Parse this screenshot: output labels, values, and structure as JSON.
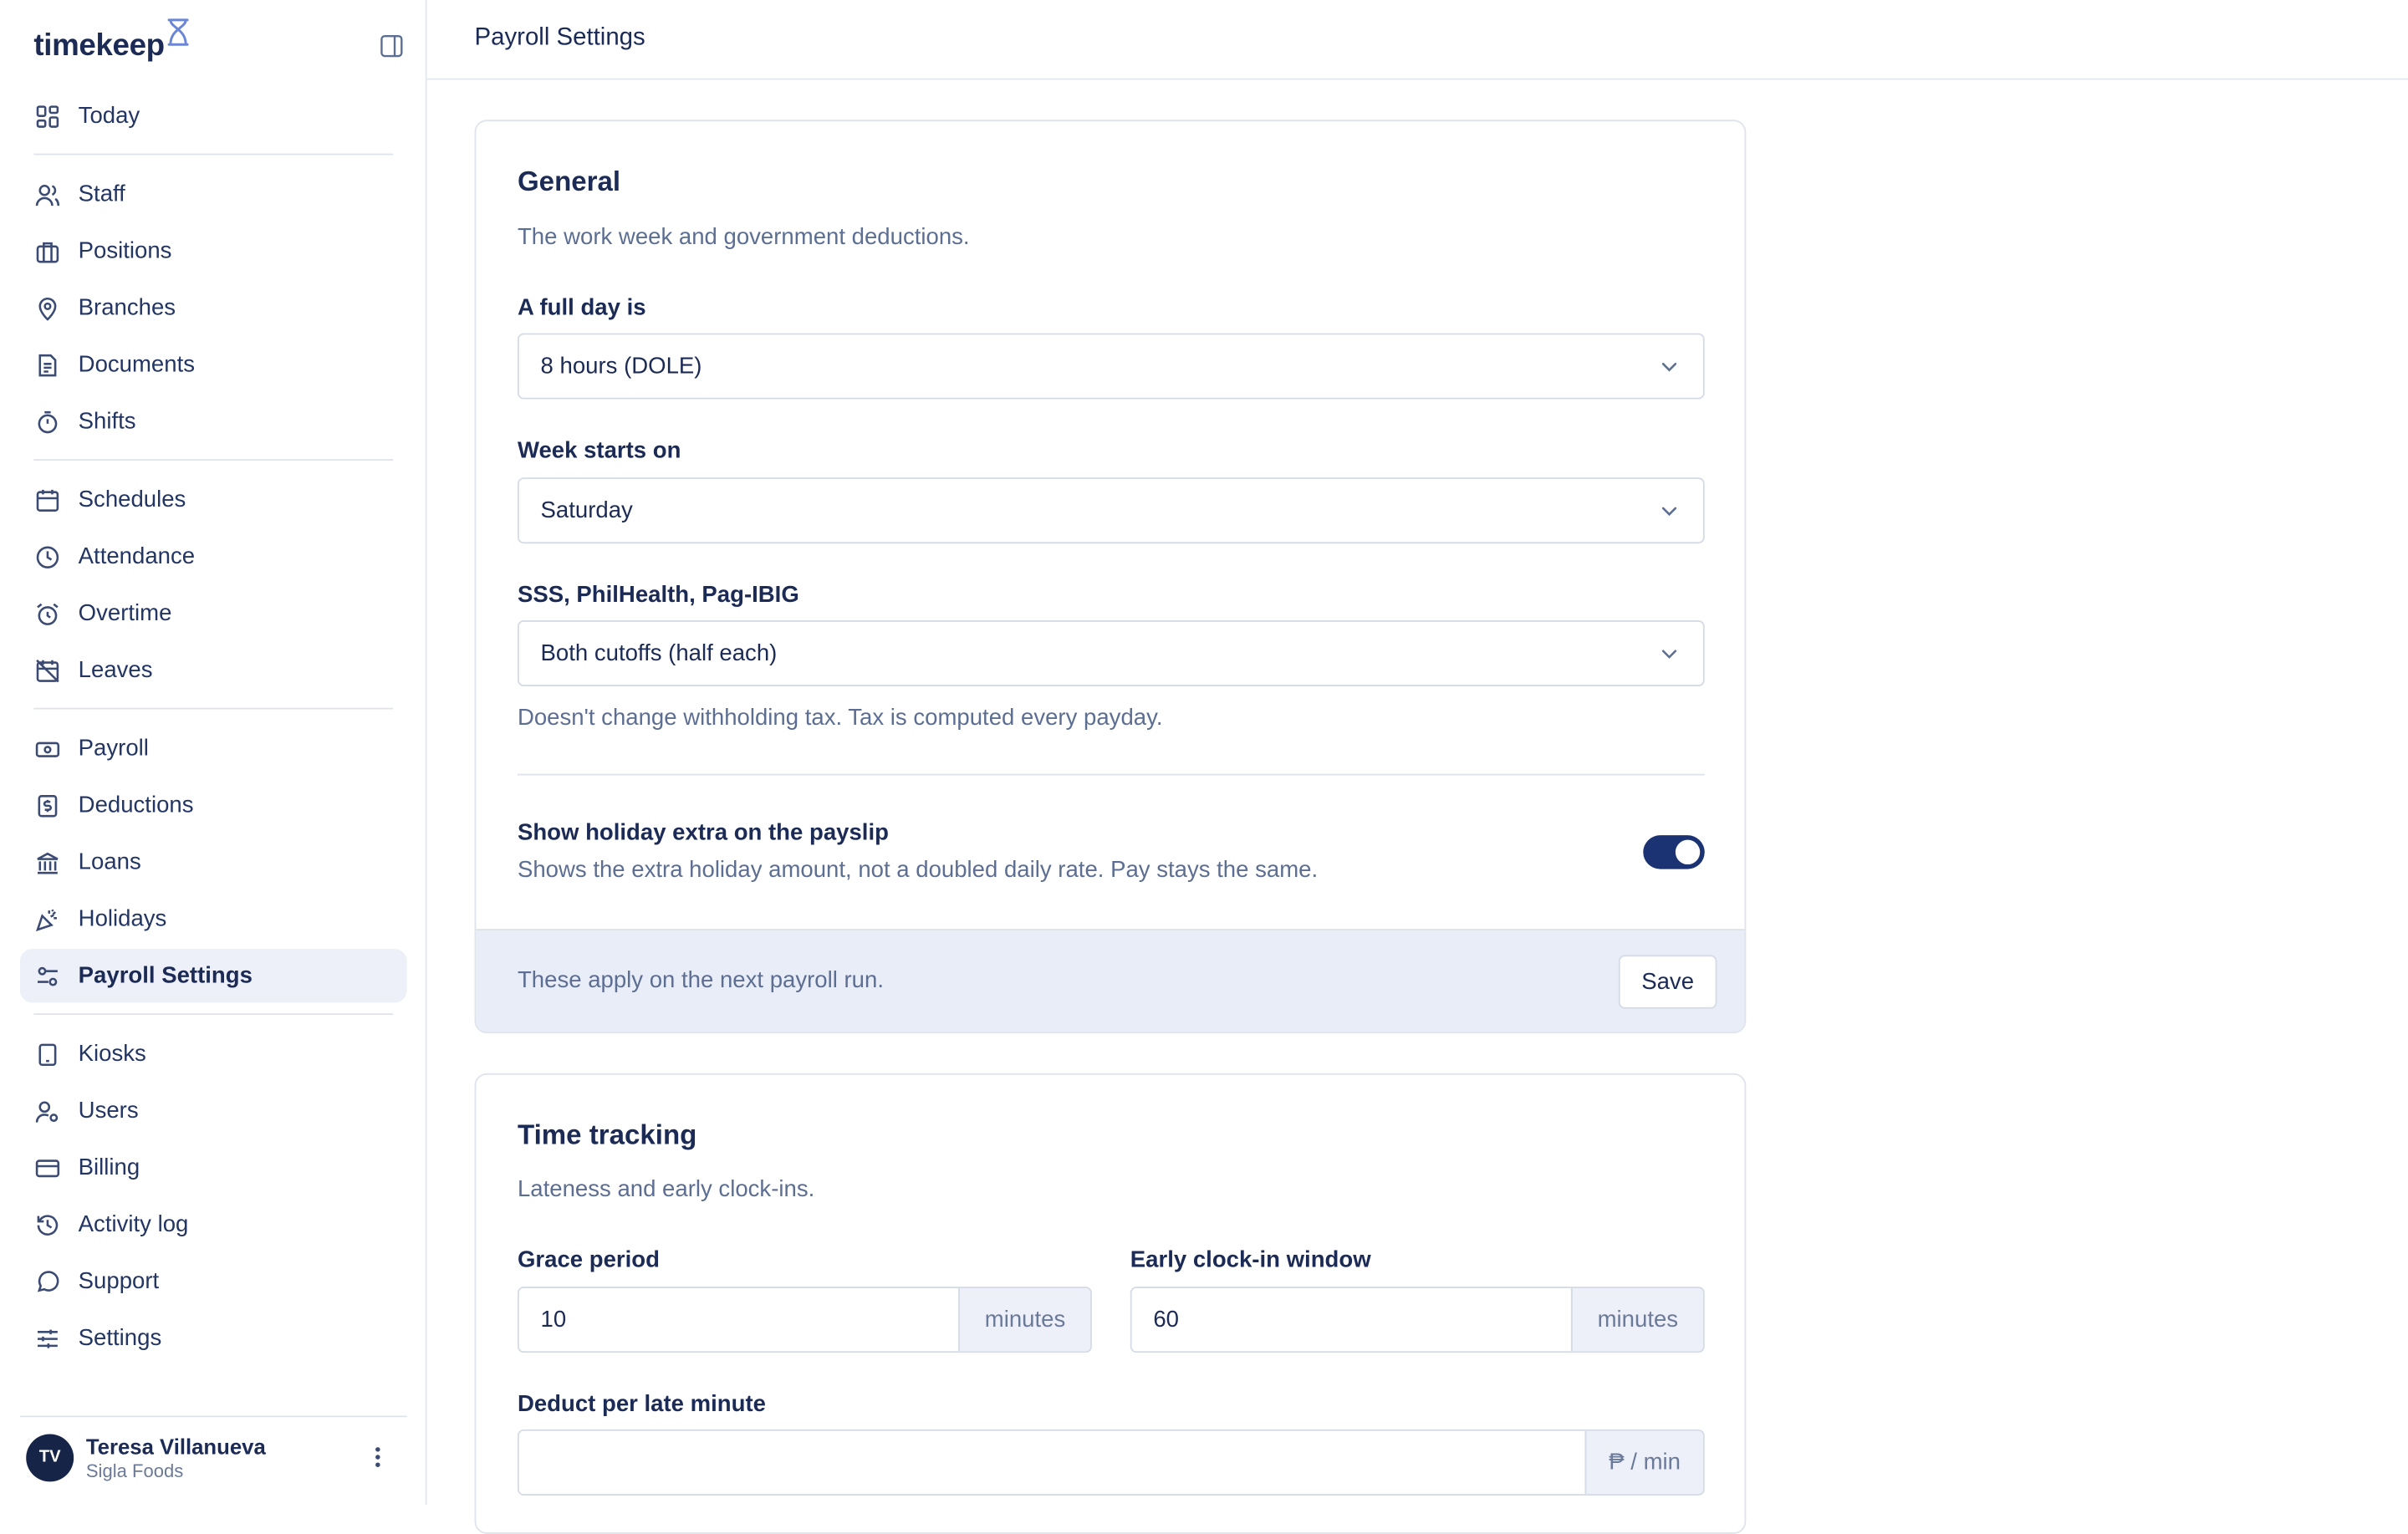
{
  "brand": {
    "name": "timekeep"
  },
  "sidebar": {
    "groups": [
      [
        {
          "label": "Today",
          "icon": "dashboard-icon"
        }
      ],
      [
        {
          "label": "Staff",
          "icon": "users-icon"
        },
        {
          "label": "Positions",
          "icon": "briefcase-icon"
        },
        {
          "label": "Branches",
          "icon": "map-pin-icon"
        },
        {
          "label": "Documents",
          "icon": "document-icon"
        },
        {
          "label": "Shifts",
          "icon": "stopwatch-icon"
        }
      ],
      [
        {
          "label": "Schedules",
          "icon": "calendar-icon"
        },
        {
          "label": "Attendance",
          "icon": "clock-icon"
        },
        {
          "label": "Overtime",
          "icon": "alarm-clock-icon"
        },
        {
          "label": "Leaves",
          "icon": "calendar-off-icon"
        }
      ],
      [
        {
          "label": "Payroll",
          "icon": "banknote-icon"
        },
        {
          "label": "Deductions",
          "icon": "receipt-dollar-icon"
        },
        {
          "label": "Loans",
          "icon": "bank-icon"
        },
        {
          "label": "Holidays",
          "icon": "party-popper-icon"
        },
        {
          "label": "Payroll Settings",
          "icon": "settings-sliders-icon",
          "active": true
        }
      ],
      [
        {
          "label": "Kiosks",
          "icon": "tablet-icon"
        },
        {
          "label": "Users",
          "icon": "user-cog-icon"
        },
        {
          "label": "Billing",
          "icon": "credit-card-icon"
        },
        {
          "label": "Activity log",
          "icon": "history-icon"
        },
        {
          "label": "Support",
          "icon": "chat-bubble-icon"
        },
        {
          "label": "Settings",
          "icon": "sliders-horizontal-icon"
        }
      ]
    ],
    "user": {
      "initials": "TV",
      "name": "Teresa Villanueva",
      "org": "Sigla Foods"
    }
  },
  "header": {
    "title": "Payroll Settings"
  },
  "general": {
    "title": "General",
    "description": "The work week and government deductions.",
    "full_day": {
      "label": "A full day is",
      "value": "8 hours (DOLE)"
    },
    "week_start": {
      "label": "Week starts on",
      "value": "Saturday"
    },
    "contributions": {
      "label": "SSS, PhilHealth, Pag-IBIG",
      "value": "Both cutoffs (half each)",
      "hint": "Doesn't change withholding tax. Tax is computed every payday."
    },
    "holiday_toggle": {
      "title": "Show holiday extra on the payslip",
      "description": "Shows the extra holiday amount, not a doubled daily rate. Pay stays the same.",
      "enabled": true
    },
    "footer": {
      "note": "These apply on the next payroll run.",
      "save_label": "Save"
    }
  },
  "time_tracking": {
    "title": "Time tracking",
    "description": "Lateness and early clock-ins.",
    "grace": {
      "label": "Grace period",
      "value": "10",
      "unit": "minutes"
    },
    "early": {
      "label": "Early clock-in window",
      "value": "60",
      "unit": "minutes"
    },
    "late_deduction": {
      "label": "Deduct per late minute",
      "value": "",
      "unit": "₱ / min"
    }
  },
  "colors": {
    "accent": "#1b3372",
    "footer_bg": "#e9edf8",
    "active_nav_bg": "#edf0f8",
    "text": "#1c2b55",
    "muted": "#5d6e93"
  }
}
